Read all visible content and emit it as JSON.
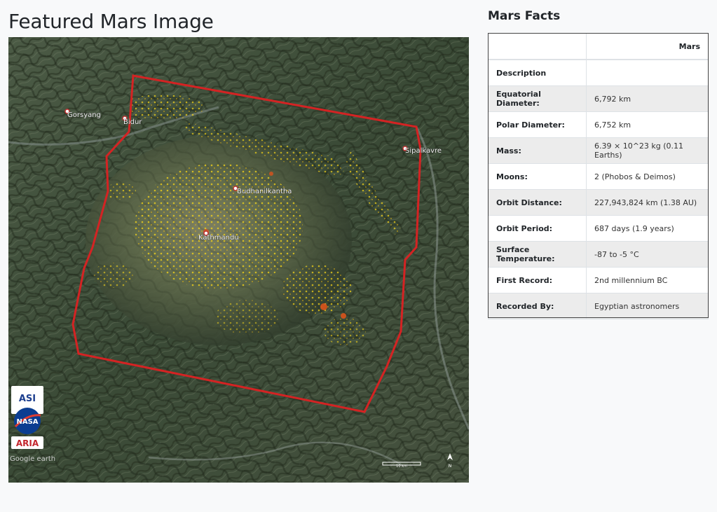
{
  "header": {
    "title": "Featured Mars Image"
  },
  "featured_image": {
    "labels": {
      "gorsyang": "Gorsyang",
      "bidur": "Bidur",
      "sipalkavre": "Sipalkavre",
      "budhanilkantha": "Budhanilkantha",
      "kathmandu": "Kathmandu"
    },
    "watermark": "Google earth",
    "scale_label": "10 km",
    "north_label": "N",
    "logos": {
      "top": "ASI",
      "middle": "NASA",
      "bottom": "ARIA"
    }
  },
  "facts": {
    "title": "Mars Facts",
    "header_col1": "",
    "header_col2": "Mars",
    "rows": [
      {
        "label": "Description",
        "value": ""
      },
      {
        "label": "Equatorial Diameter:",
        "value": "6,792 km"
      },
      {
        "label": "Polar Diameter:",
        "value": "6,752 km"
      },
      {
        "label": "Mass:",
        "value": "6.39 × 10^23 kg (0.11 Earths)"
      },
      {
        "label": "Moons:",
        "value": "2 (Phobos & Deimos)"
      },
      {
        "label": "Orbit Distance:",
        "value": "227,943,824 km (1.38 AU)"
      },
      {
        "label": "Orbit Period:",
        "value": "687 days (1.9 years)"
      },
      {
        "label": "Surface Temperature:",
        "value": "-87 to -5 °C"
      },
      {
        "label": "First Record:",
        "value": "2nd millennium BC"
      },
      {
        "label": "Recorded By:",
        "value": "Egyptian astronomers"
      }
    ]
  },
  "colors": {
    "page_background": "#f8f9fa",
    "boundary_red": "#d42323",
    "damage_yellow": "#f2d21a",
    "terrain_dark": "#2f3a2c"
  }
}
